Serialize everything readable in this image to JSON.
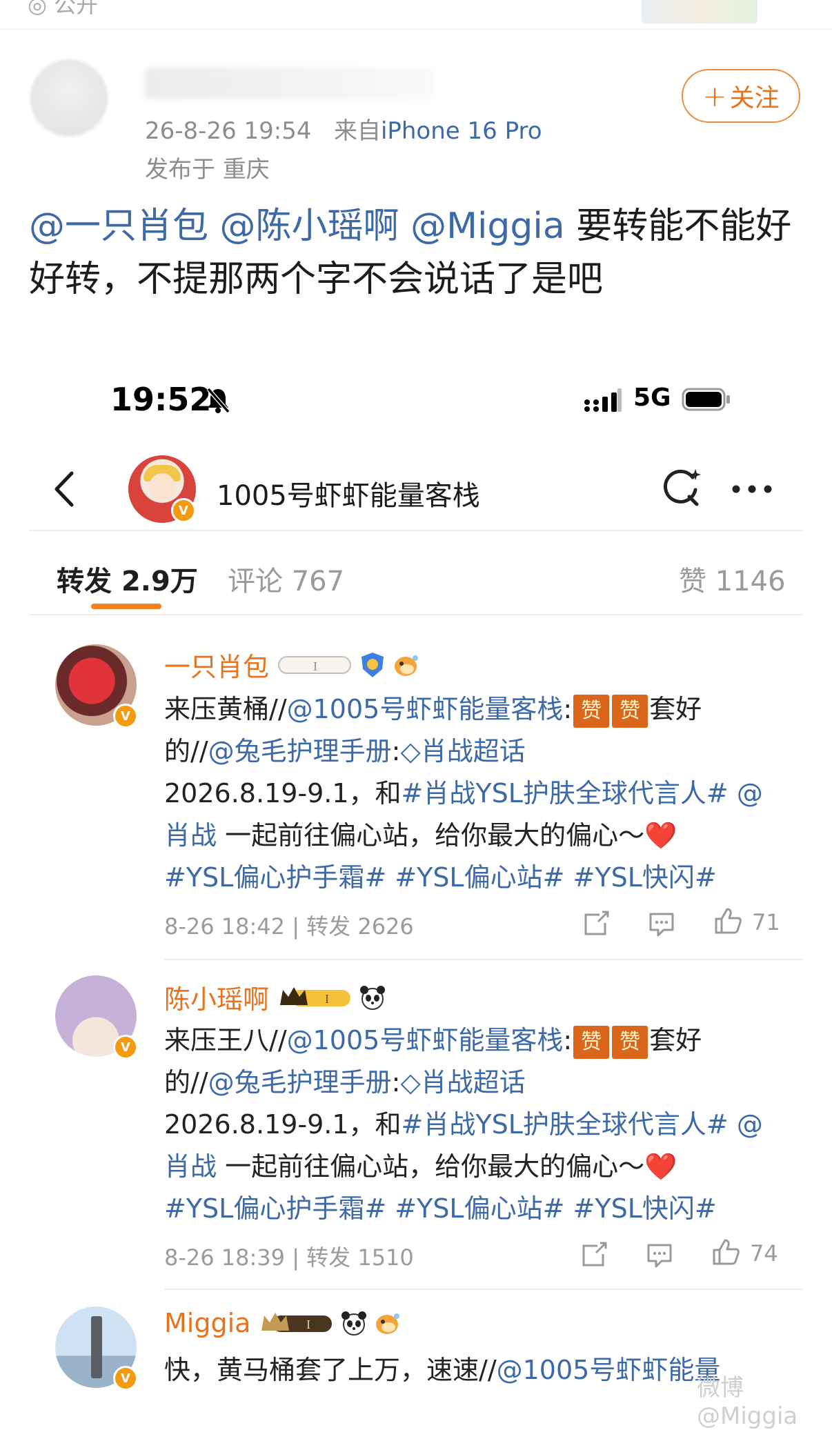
{
  "top_fragment": {
    "text": "◎ 公开"
  },
  "post": {
    "timestamp": "26-8-26 19:54",
    "source_prefix": "来自",
    "source": "iPhone 16 Pro",
    "location": "发布于 重庆",
    "follow_label": "关注",
    "body_mentions": [
      "@一只肖包",
      "@陈小瑶啊",
      "@Miggia"
    ],
    "body_text": " 要转能不能好好转，不提那两个字不会说话了是吧"
  },
  "status_bar": {
    "time": "19:52",
    "network": "5G"
  },
  "nav": {
    "title": "1005号虾虾能量客栈",
    "verified_badge": "V"
  },
  "tabs": {
    "repost_label": "转发",
    "repost_count": "2.9万",
    "comment_label": "评论",
    "comment_count": "767",
    "like_label": "赞",
    "like_count": "1146"
  },
  "reposts": [
    {
      "username": "一只肖包",
      "lead": "来压黄桶",
      "sep1": "//",
      "mention1": "@1005号虾虾能量客栈",
      "colon1": ":",
      "zan": "赞",
      "after_zan": "套好的",
      "sep2": "//",
      "mention2": "@兔毛护理手册",
      "colon2": ":",
      "topic": "肖战超话",
      "date_text": "2026.8.19-9.1，和",
      "hashtag1": "#肖战YSL护肤全球代言人#",
      "mention3": "@肖战",
      "sentence": " 一起前往偏心站，给你最大的偏心～",
      "heart": "❤️",
      "hashtags": "#YSL偏心护手霜# #YSL偏心站# #YSL快闪#",
      "time": "8-26 18:42",
      "repost_label": "转发",
      "repost_count": "2626",
      "like_count": "71"
    },
    {
      "username": "陈小瑶啊",
      "lead": "来压王八",
      "sep1": "//",
      "mention1": "@1005号虾虾能量客栈",
      "colon1": ":",
      "zan": "赞",
      "after_zan": "套好的",
      "sep2": "//",
      "mention2": "@兔毛护理手册",
      "colon2": ":",
      "topic": "肖战超话",
      "date_text": "2026.8.19-9.1，和",
      "hashtag1": "#肖战YSL护肤全球代言人#",
      "mention3": "@肖战",
      "sentence": " 一起前往偏心站，给你最大的偏心～",
      "heart": "❤️",
      "hashtags": "#YSL偏心护手霜# #YSL偏心站# #YSL快闪#",
      "time": "8-26 18:39",
      "repost_label": "转发",
      "repost_count": "1510",
      "like_count": "74"
    },
    {
      "username": "Miggia",
      "lead": "快，黄马桶套了上万，速速",
      "sep1": "//",
      "mention1": "@1005号虾虾能量"
    }
  ],
  "watermark": "微博@Miggia",
  "colors": {
    "accent": "#e8721d",
    "link": "#3d6aa6",
    "meta": "#9a9a9a"
  }
}
